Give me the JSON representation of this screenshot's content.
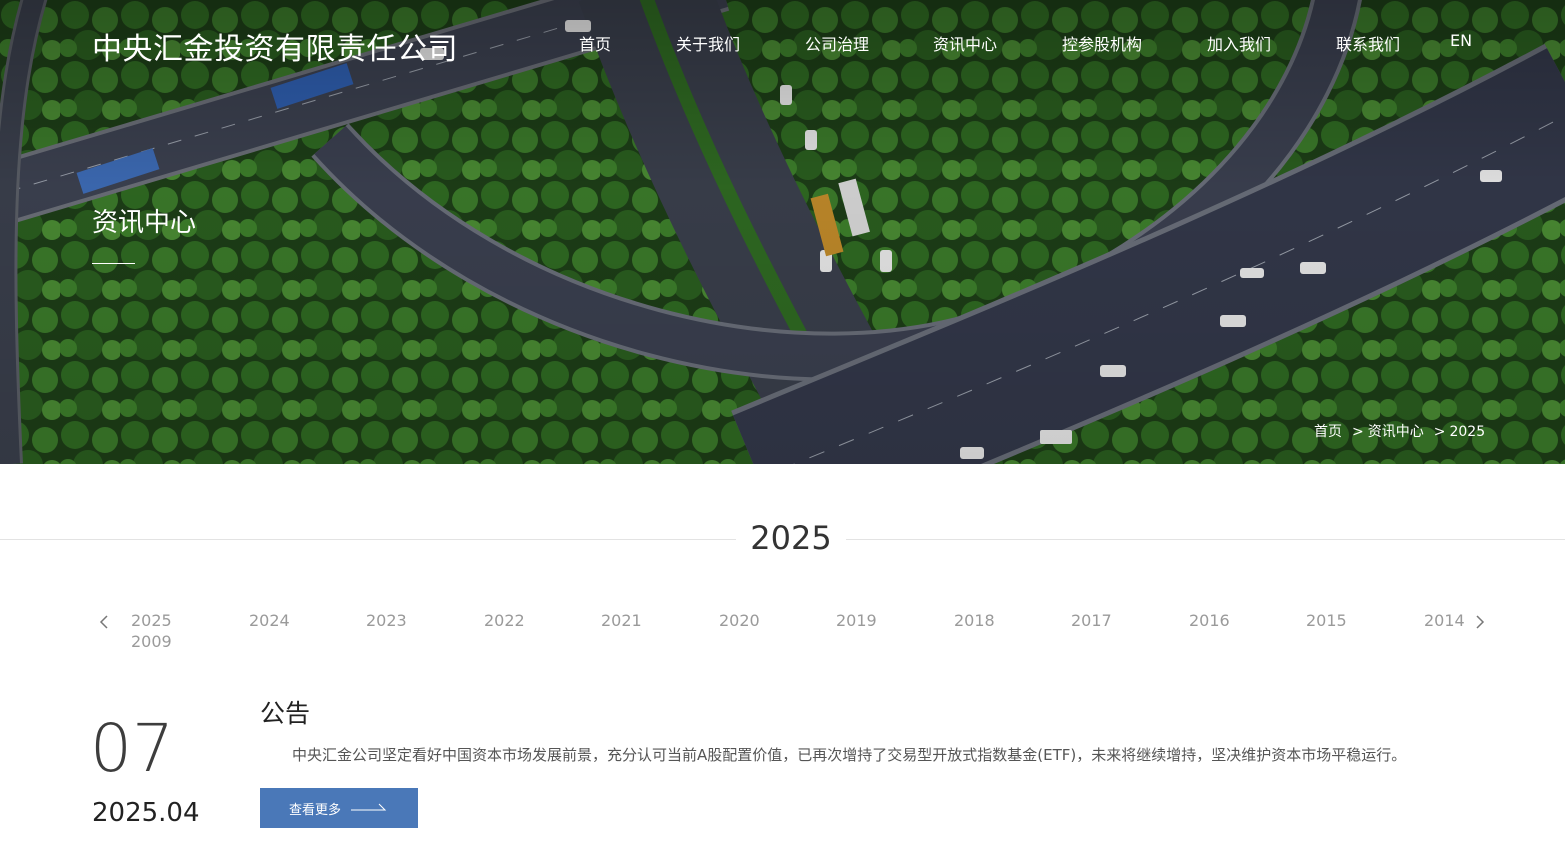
{
  "header": {
    "logo": "中央汇金投资有限责任公司",
    "nav": [
      "首页",
      "关于我们",
      "公司治理",
      "资讯中心",
      "控参股机构",
      "加入我们",
      "联系我们",
      "EN"
    ]
  },
  "hero": {
    "title": "资讯中心",
    "breadcrumb": [
      "首页",
      "资讯中心",
      "2025"
    ],
    "breadcrumb_separator": ">"
  },
  "year_heading": "2025",
  "year_tabs": [
    "2025",
    "2024",
    "2023",
    "2022",
    "2021",
    "2020",
    "2019",
    "2018",
    "2017",
    "2016",
    "2015",
    "2014",
    "2009"
  ],
  "news": {
    "day": "07",
    "month": "2025.04",
    "title": "公告",
    "summary": "中央汇金公司坚定看好中国资本市场发展前景，充分认可当前A股配置价值，已再次增持了交易型开放式指数基金(ETF)，未来将继续增持，坚决维护资本市场平稳运行。",
    "more_label": "查看更多"
  },
  "colors": {
    "button": "#4a78b8",
    "tab_text": "#9a9a9a",
    "heading_text": "#333333"
  },
  "icons": {
    "prev": "chevron-left-icon",
    "next": "chevron-right-icon",
    "more": "arrow-right-icon"
  }
}
